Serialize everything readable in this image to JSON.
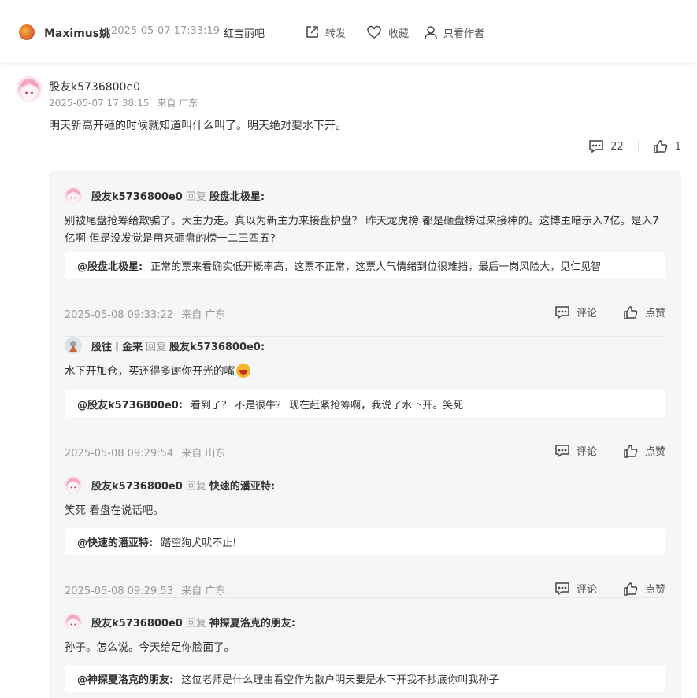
{
  "header": {
    "username": "Maximus姚",
    "time": "2025-05-07 17:33:19",
    "forum": "红宝丽吧",
    "share_label": "转发",
    "fav_label": "收藏",
    "author_only_label": "只看作者"
  },
  "comment": {
    "username": "股友k5736800e0",
    "time": "2025-05-07 17:38:15",
    "location": "来自 广东",
    "text": "明天新高开砸的时候就知道叫什么叫了。明天绝对要水下开。",
    "comment_count": "22",
    "like_count": "1"
  },
  "reply_word": "回复",
  "comment_label": "评论",
  "like_label": "点赞",
  "replies": [
    {
      "user": "股友k5736800e0",
      "target": "股盘北极星:",
      "text": "别被尾盘抢筹给欺骗了。大主力走。真以为新主力来接盘护盘？ 昨天龙虎榜 都是砸盘榜过来接棒的。这博主暗示入7亿。是入7亿啊 但是没发觉是用来砸盘的榜一二三四五?",
      "quote_user": "@股盘北极星:",
      "quote_text": "正常的票来看确实低开概率高，这票不正常，这票人气情绪到位很难挡，最后一岗风险大，见仁见智",
      "time": "2025-05-08 09:33:22",
      "location": "来自 广东"
    },
    {
      "user": "股往丨金来",
      "target": "股友k5736800e0:",
      "text": "水下开加仓，买还得多谢你开光的嘴",
      "quote_user": "@股友k5736800e0:",
      "quote_text": "看到了？ 不是很牛？ 现在赶紧抢筹啊，我说了水下开。笑死",
      "time": "2025-05-08 09:29:54",
      "location": "来自 山东"
    },
    {
      "user": "股友k5736800e0",
      "target": "快速的潘亚特:",
      "text": "笑死 看盘在说话吧。",
      "quote_user": "@快速的潘亚特:",
      "quote_text": "踏空狗犬吠不止!",
      "time": "2025-05-08 09:29:53",
      "location": "来自 广东"
    },
    {
      "user": "股友k5736800e0",
      "target": "神探夏洛克的朋友:",
      "text": "孙子。怎么说。今天给足你脸面了。",
      "quote_user": "@神探夏洛克的朋友:",
      "quote_text": "这位老师是什么理由看空作为散户明天要是水下开我不抄底你叫我孙子"
    }
  ]
}
